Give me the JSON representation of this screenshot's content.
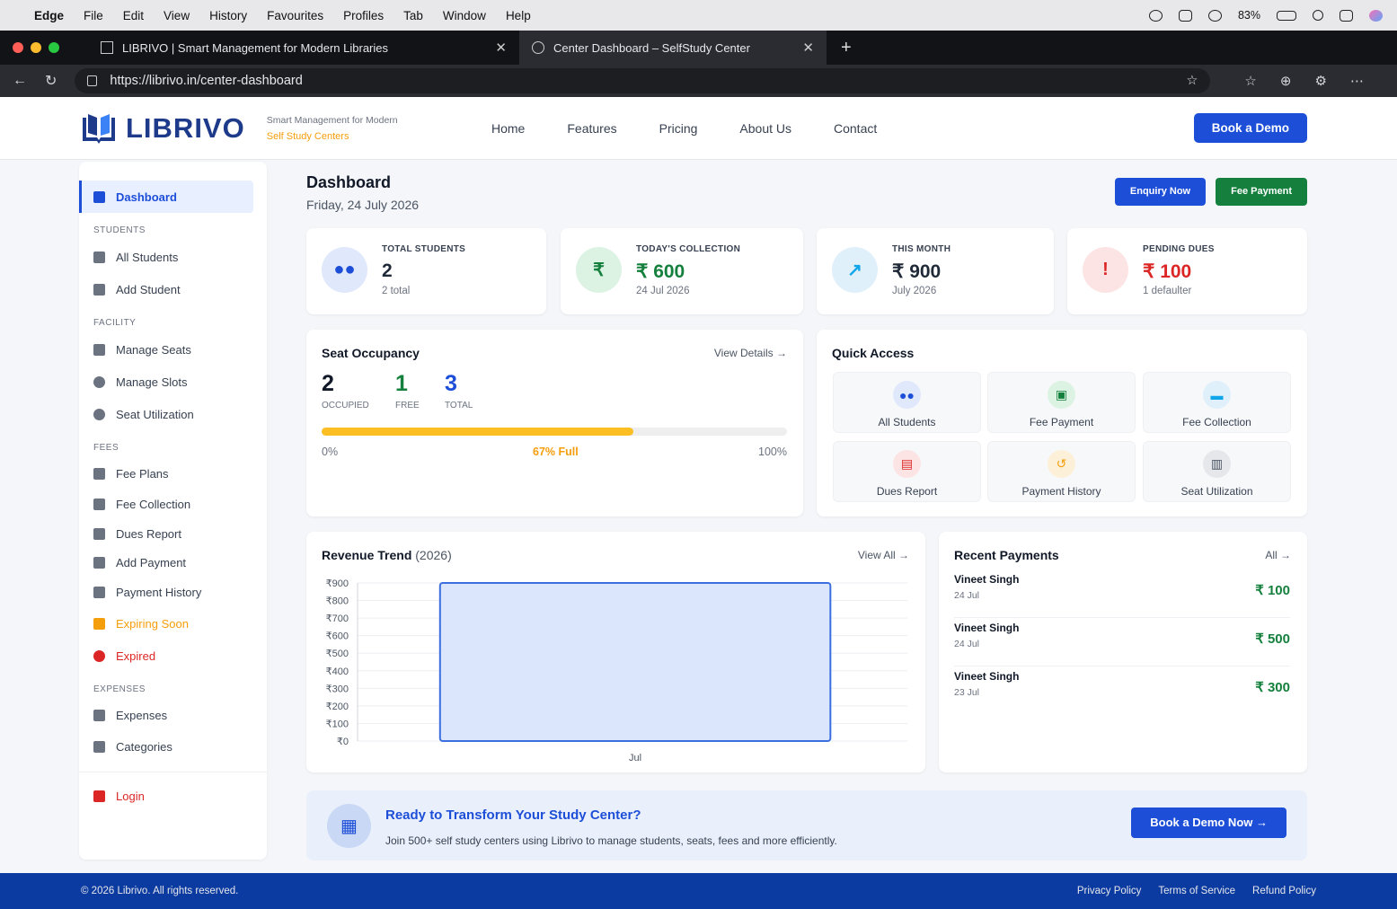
{
  "menubar": {
    "apple": "",
    "app": "Edge",
    "items": [
      "File",
      "Edit",
      "View",
      "History",
      "Favourites",
      "Profiles",
      "Tab",
      "Window",
      "Help"
    ],
    "battery": "83%"
  },
  "tabs": [
    {
      "title": "LIBRIVO | Smart Management for Modern Libraries"
    },
    {
      "title": "Center Dashboard – SelfStudy Center"
    }
  ],
  "url": "https://librivo.in/center-dashboard",
  "nav": {
    "logo": "LIBRIVO",
    "tagline1": "Smart Management for Modern",
    "tagline2": "Self Study Centers",
    "links": [
      "Home",
      "Features",
      "Pricing",
      "About Us",
      "Contact"
    ],
    "cta": "Book a Demo"
  },
  "sidebar": {
    "dashboard": "Dashboard",
    "students_head": "STUDENTS",
    "all_students": "All Students",
    "add_student": "Add Student",
    "facility_head": "FACILITY",
    "manage_seats": "Manage Seats",
    "manage_slots": "Manage Slots",
    "seat_util": "Seat Utilization",
    "fees_head": "FEES",
    "fee_plans": "Fee Plans",
    "fee_collection": "Fee Collection",
    "dues_report": "Dues Report",
    "add_payment": "Add Payment",
    "payment_history": "Payment History",
    "expiring": "Expiring Soon",
    "expired": "Expired",
    "expenses_head": "EXPENSES",
    "expenses": "Expenses",
    "categories": "Categories",
    "login": "Login"
  },
  "page": {
    "title": "Dashboard",
    "date": "Friday, 24 July 2026",
    "enquiry": "Enquiry Now",
    "fee_payment": "Fee Payment"
  },
  "stats": [
    {
      "label": "TOTAL STUDENTS",
      "value": "2",
      "sub": "2 total",
      "color": "#1f2937"
    },
    {
      "label": "TODAY'S COLLECTION",
      "value": "₹ 600",
      "sub": "24 Jul 2026",
      "color": "#15803d"
    },
    {
      "label": "THIS MONTH",
      "value": "₹ 900",
      "sub": "July 2026",
      "color": "#1f2937"
    },
    {
      "label": "PENDING DUES",
      "value": "₹ 100",
      "sub": "1 defaulter",
      "color": "#dc2626"
    }
  ],
  "occupancy": {
    "title": "Seat Occupancy",
    "link": "View Details →",
    "occupied": "2",
    "occupied_label": "OCCUPIED",
    "free": "1",
    "free_label": "FREE",
    "total": "3",
    "total_label": "TOTAL",
    "percent": 0.67,
    "min": "0%",
    "mid": "67% Full",
    "max": "100%"
  },
  "quick": {
    "title": "Quick Access",
    "items": [
      "All Students",
      "Fee Payment",
      "Fee Collection",
      "Dues Report",
      "Payment History",
      "Seat Utilization"
    ]
  },
  "revenue": {
    "title": "Revenue Trend",
    "year": "(2026)",
    "link": "View All →"
  },
  "chart_data": {
    "type": "bar",
    "categories": [
      "Jul"
    ],
    "values": [
      900
    ],
    "ylim": [
      0,
      900
    ],
    "yticks": [
      "₹900",
      "₹800",
      "₹700",
      "₹600",
      "₹500",
      "₹400",
      "₹300",
      "₹200",
      "₹100",
      "₹0"
    ],
    "grid": true
  },
  "recent": {
    "title": "Recent Payments",
    "link": "All →",
    "items": [
      {
        "name": "Vineet Singh",
        "date": "24 Jul",
        "amount": "₹ 100"
      },
      {
        "name": "Vineet Singh",
        "date": "24 Jul",
        "amount": "₹ 500"
      },
      {
        "name": "Vineet Singh",
        "date": "23 Jul",
        "amount": "₹ 300"
      }
    ]
  },
  "cta": {
    "title": "Ready to Transform Your Study Center?",
    "text": "Join 500+ self study centers using Librivo to manage students, seats, fees and more efficiently.",
    "button": "Book a Demo Now →"
  },
  "footer": {
    "copy": "© 2026 Librivo. All rights reserved.",
    "links": [
      "Privacy Policy",
      "Terms of Service",
      "Refund Policy"
    ]
  }
}
